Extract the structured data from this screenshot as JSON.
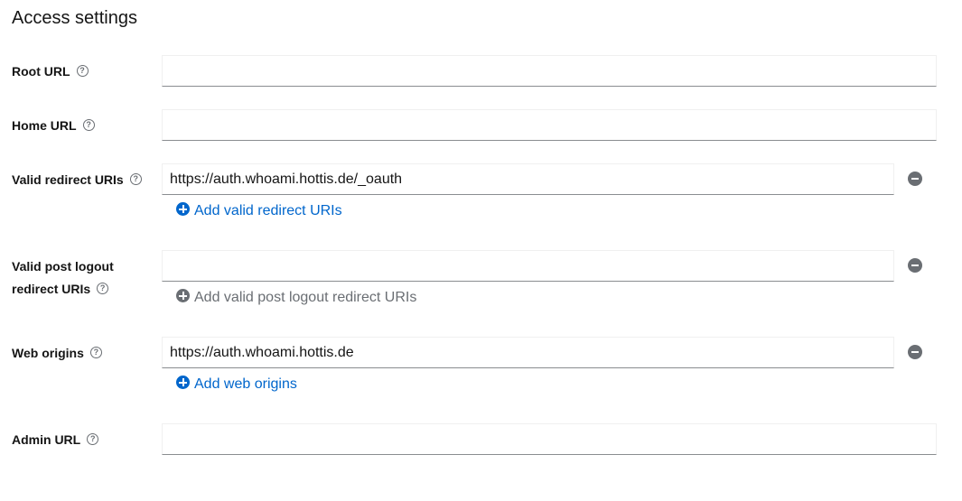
{
  "section": {
    "title": "Access settings"
  },
  "root_url": {
    "label": "Root URL",
    "value": ""
  },
  "home_url": {
    "label": "Home URL",
    "value": ""
  },
  "redirect_uris": {
    "label": "Valid redirect URIs",
    "value": "https://auth.whoami.hottis.de/_oauth",
    "add_label": "Add valid redirect URIs"
  },
  "post_logout": {
    "label_line1": "Valid post logout",
    "label_line2": "redirect URIs",
    "value": "",
    "add_label": "Add valid post logout redirect URIs"
  },
  "web_origins": {
    "label": "Web origins",
    "value": "https://auth.whoami.hottis.de",
    "add_label": "Add web origins"
  },
  "admin_url": {
    "label": "Admin URL",
    "value": ""
  },
  "icons": {
    "help": "?"
  }
}
